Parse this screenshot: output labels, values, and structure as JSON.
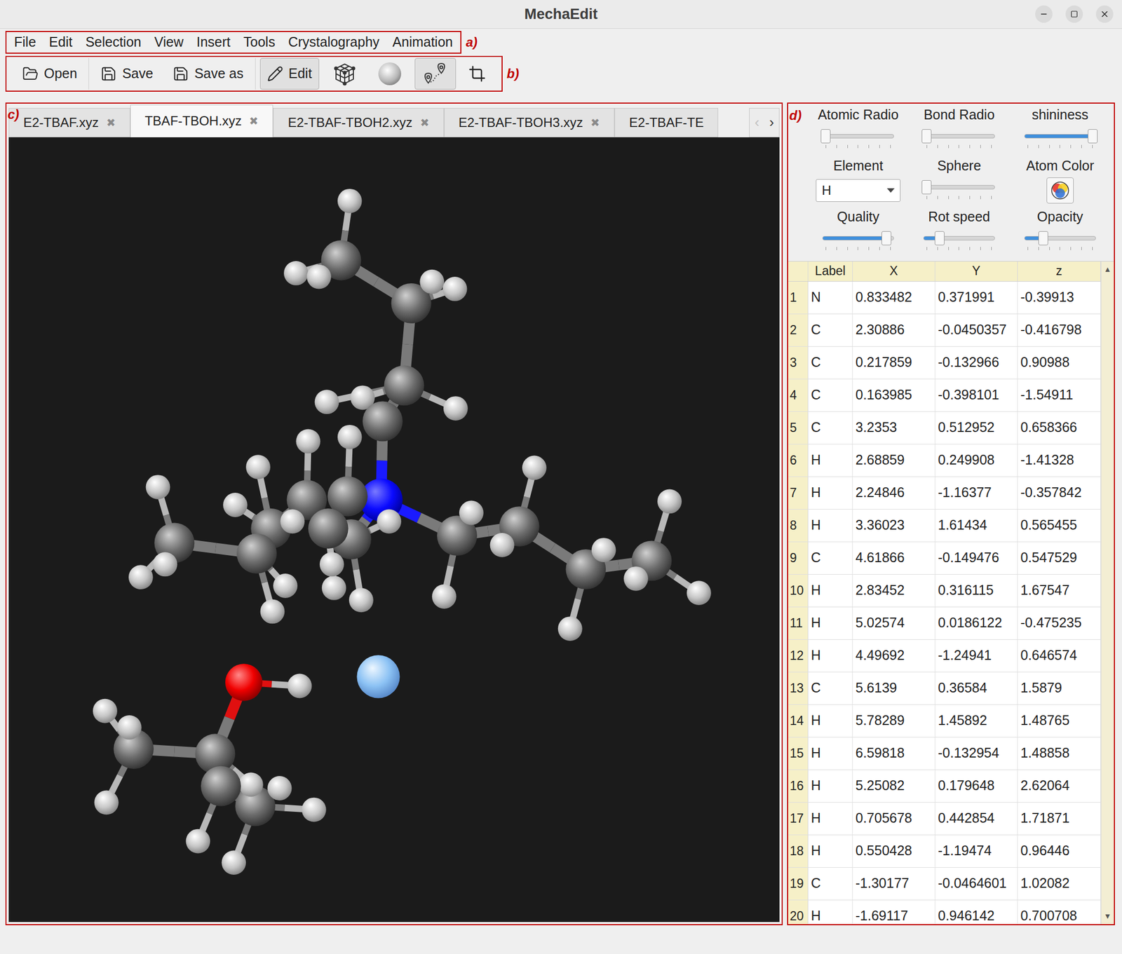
{
  "window": {
    "title": "MechaEdit"
  },
  "annotations": {
    "menu": "a)",
    "toolbar": "b)",
    "viewer": "c)",
    "panel": "d)"
  },
  "menu": [
    "File",
    "Edit",
    "Selection",
    "View",
    "Insert",
    "Tools",
    "Crystalography",
    "Animation"
  ],
  "toolbar": [
    [
      {
        "label": "Open",
        "kind": "open",
        "pressed": false
      }
    ],
    [
      {
        "label": "Save",
        "kind": "save",
        "pressed": false
      },
      {
        "label": "Save as",
        "kind": "save",
        "pressed": false
      }
    ],
    [
      {
        "label": "Edit",
        "kind": "edit",
        "pressed": true
      },
      {
        "label": "",
        "kind": "lattice",
        "pressed": false
      },
      {
        "label": "",
        "kind": "sphere",
        "pressed": false
      },
      {
        "label": "",
        "kind": "path",
        "pressed": true
      },
      {
        "label": "",
        "kind": "crop",
        "pressed": false
      }
    ]
  ],
  "tabs": [
    {
      "label": "E2-TBAF.xyz",
      "close": "✖",
      "selected": false
    },
    {
      "label": "TBAF-TBOH.xyz",
      "close": "✖",
      "selected": true
    },
    {
      "label": "E2-TBAF-TBOH2.xyz",
      "close": "✖",
      "selected": false
    },
    {
      "label": "E2-TBAF-TBOH3.xyz",
      "close": "✖",
      "selected": false
    },
    {
      "label": "E2-TBAF-TE",
      "close": "",
      "selected": false
    }
  ],
  "tab_scroll": [
    "‹",
    "›"
  ],
  "panel": {
    "controls": [
      {
        "label": "Atomic Radio",
        "kind": "slider",
        "level": 0.04
      },
      {
        "label": "Bond Radio",
        "kind": "slider",
        "level": 0.04
      },
      {
        "label": "shininess",
        "kind": "slider",
        "level": 0.96
      },
      {
        "label": "Element",
        "kind": "dropdown",
        "value": "H"
      },
      {
        "label": "Sphere",
        "kind": "slider",
        "level": 0.04
      },
      {
        "label": "Atom Color",
        "kind": "color"
      },
      {
        "label": "Quality",
        "kind": "slider",
        "level": 0.9
      },
      {
        "label": "Rot speed",
        "kind": "slider",
        "level": 0.22
      },
      {
        "label": "Opacity",
        "kind": "slider",
        "level": 0.26
      }
    ]
  },
  "table": {
    "columns": [
      "Label",
      "X",
      "Y",
      "z"
    ],
    "scroll_up": "▲",
    "scroll_down": "▼",
    "rows": [
      [
        "1",
        "N",
        "0.833482",
        "0.371991",
        "-0.39913"
      ],
      [
        "2",
        "C",
        "2.30886",
        "-0.0450357",
        "-0.416798"
      ],
      [
        "3",
        "C",
        "0.217859",
        "-0.132966",
        "0.90988"
      ],
      [
        "4",
        "C",
        "0.163985",
        "-0.398101",
        "-1.54911"
      ],
      [
        "5",
        "C",
        "3.2353",
        "0.512952",
        "0.658366"
      ],
      [
        "6",
        "H",
        "2.68859",
        "0.249908",
        "-1.41328"
      ],
      [
        "7",
        "H",
        "2.24846",
        "-1.16377",
        "-0.357842"
      ],
      [
        "8",
        "H",
        "3.36023",
        "1.61434",
        "0.565455"
      ],
      [
        "9",
        "C",
        "4.61866",
        "-0.149476",
        "0.547529"
      ],
      [
        "10",
        "H",
        "2.83452",
        "0.316115",
        "1.67547"
      ],
      [
        "11",
        "H",
        "5.02574",
        "0.0186122",
        "-0.475235"
      ],
      [
        "12",
        "H",
        "4.49692",
        "-1.24941",
        "0.646574"
      ],
      [
        "13",
        "C",
        "5.6139",
        "0.36584",
        "1.5879"
      ],
      [
        "14",
        "H",
        "5.78289",
        "1.45892",
        "1.48765"
      ],
      [
        "15",
        "H",
        "6.59818",
        "-0.132954",
        "1.48858"
      ],
      [
        "16",
        "H",
        "5.25082",
        "0.179648",
        "2.62064"
      ],
      [
        "17",
        "H",
        "0.705678",
        "0.442854",
        "1.71871"
      ],
      [
        "18",
        "H",
        "0.550428",
        "-1.19474",
        "0.96446"
      ],
      [
        "19",
        "C",
        "-1.30177",
        "-0.0464601",
        "1.02082"
      ],
      [
        "20",
        "H",
        "-1.69117",
        "0.946142",
        "0.700708"
      ]
    ]
  }
}
